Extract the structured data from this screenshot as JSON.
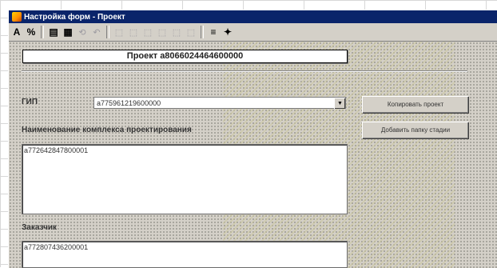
{
  "window": {
    "title": "Настройка форм - Проект"
  },
  "toolbar": {
    "items": [
      {
        "glyph": "A",
        "name": "font-icon"
      },
      {
        "glyph": "%",
        "name": "percent-icon"
      },
      {
        "glyph": "▤",
        "name": "table-icon"
      },
      {
        "glyph": "▦",
        "name": "grid-icon"
      },
      {
        "glyph": "⟲",
        "name": "undo-icon"
      },
      {
        "glyph": "↶",
        "name": "redo-icon"
      },
      {
        "glyph": "⬚",
        "name": "align-left-icon"
      },
      {
        "glyph": "⬚",
        "name": "align-center-icon"
      },
      {
        "glyph": "⬚",
        "name": "align-right-icon"
      },
      {
        "glyph": "⬚",
        "name": "align-top-icon"
      },
      {
        "glyph": "⬚",
        "name": "align-bottom-icon"
      },
      {
        "glyph": "⬚",
        "name": "size-icon"
      },
      {
        "glyph": "≡",
        "name": "properties-icon"
      },
      {
        "glyph": "✦",
        "name": "settings-icon"
      }
    ]
  },
  "form": {
    "project_header": "Проект a8066024464600000",
    "gip_label": "ГИП",
    "gip_value": "a775961219600000",
    "copy_button": "Копировать проект",
    "add_folder_button": "Добавить папку стадии",
    "complex_label": "Наименование комплекса проектирования",
    "complex_value": "a772642847800001",
    "customer_label": "Заказчик",
    "customer_value": "a772807436200001"
  }
}
